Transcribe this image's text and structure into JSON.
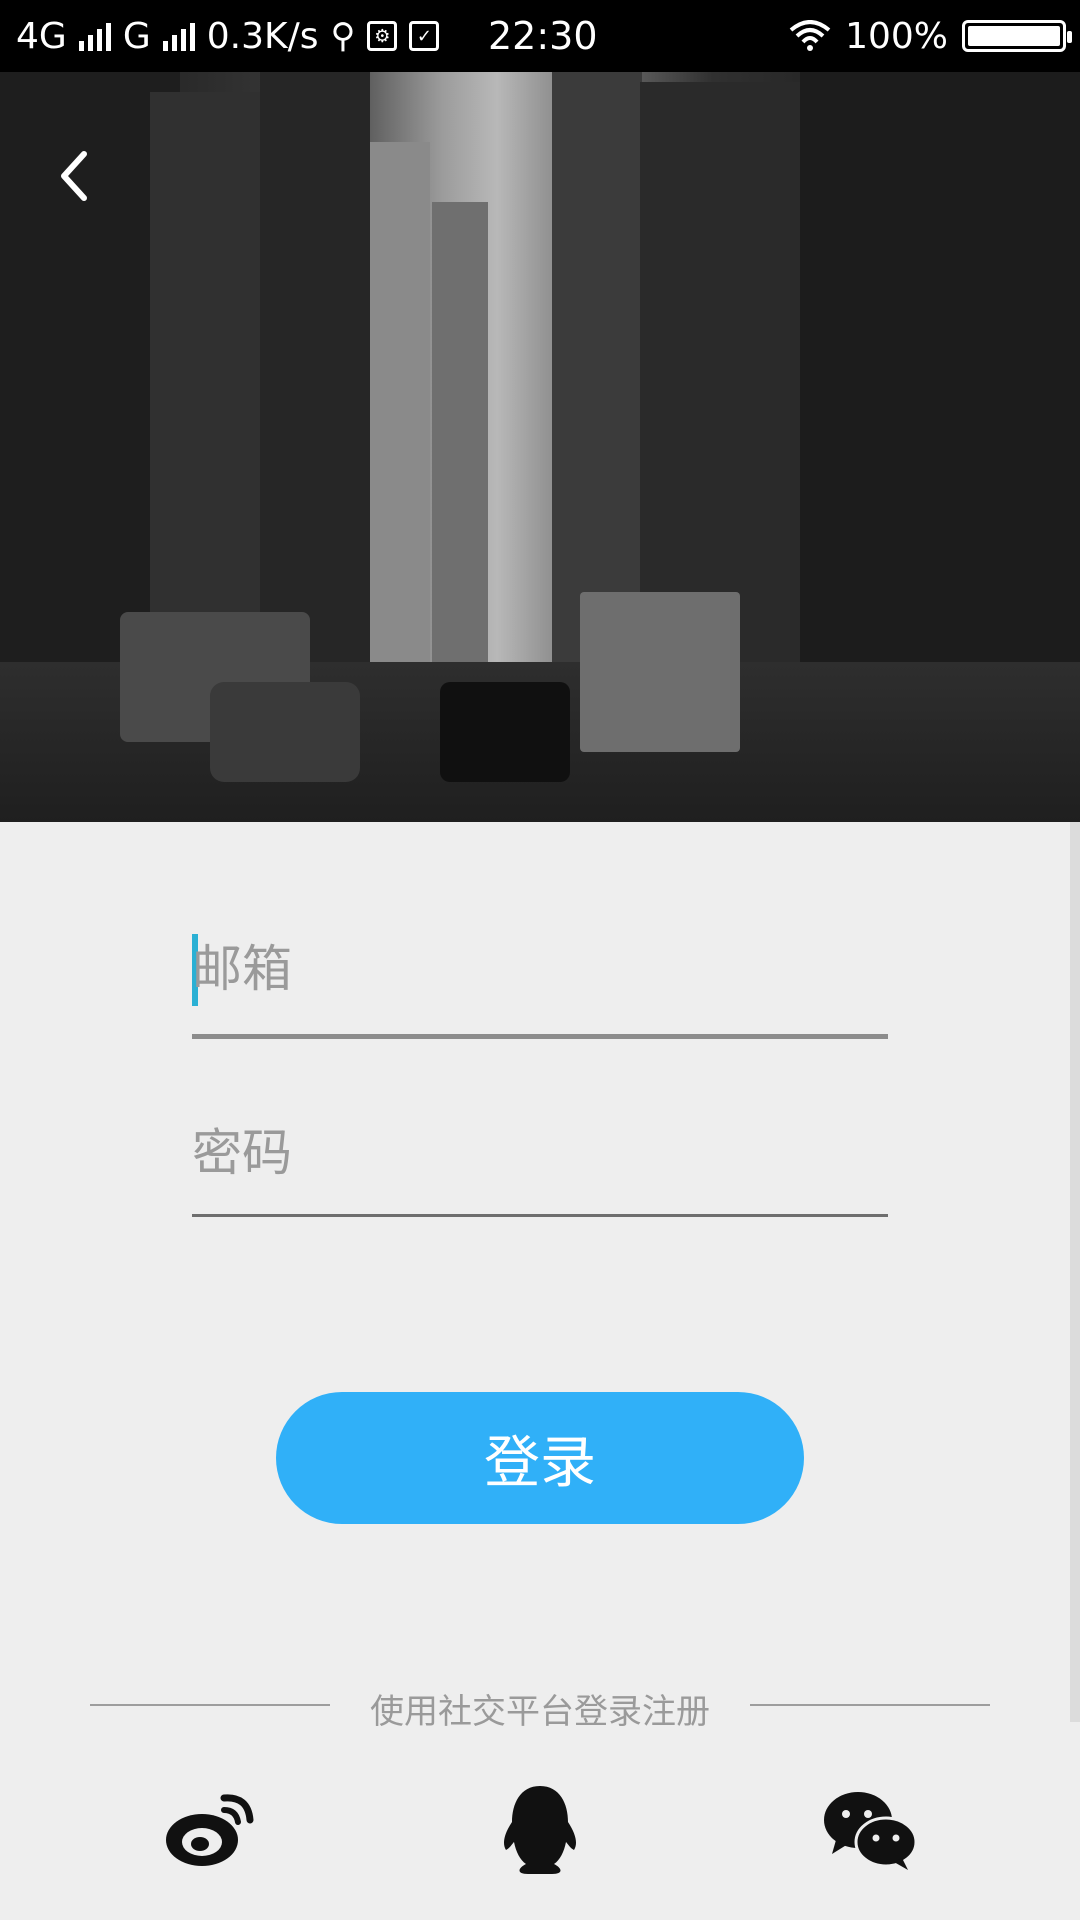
{
  "status_bar": {
    "network1": "4G",
    "network2": "G",
    "speed": "0.3K/s",
    "time": "22:30",
    "battery": "100%"
  },
  "form": {
    "email_placeholder": "邮箱",
    "password_placeholder": "密码",
    "login_label": "登录"
  },
  "social": {
    "prompt": "使用社交平台登录注册",
    "icons": [
      "weibo-icon",
      "qq-icon",
      "wechat-icon"
    ]
  },
  "colors": {
    "accent": "#30b0f8",
    "cursor": "#2ab0d4",
    "background": "#eeeeee"
  }
}
